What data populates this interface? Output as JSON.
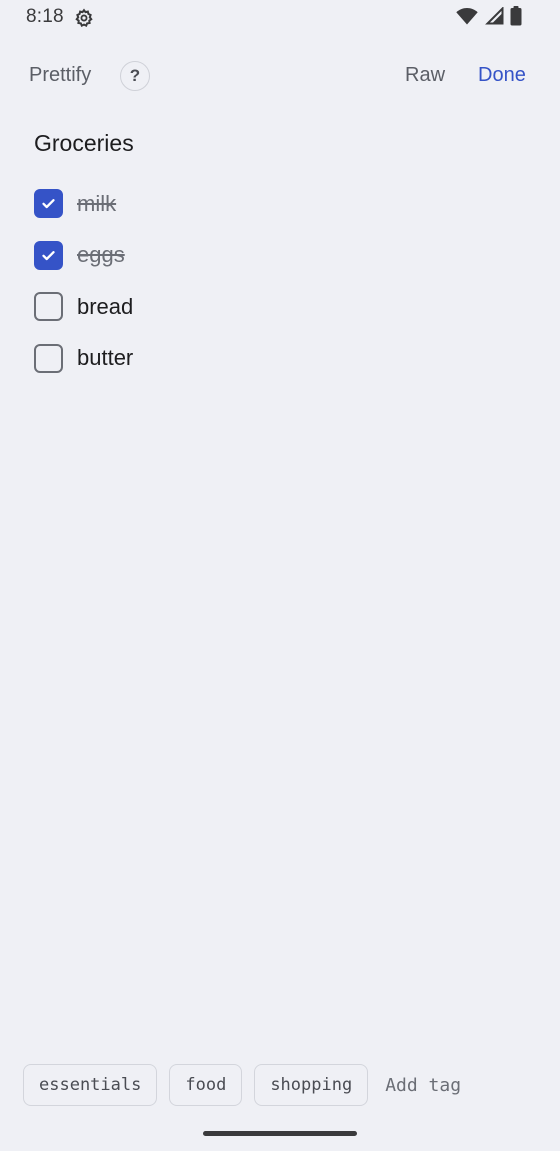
{
  "status_bar": {
    "time": "8:18",
    "icons": [
      "settings-gear-icon",
      "wifi-icon",
      "cell-signal-icon",
      "battery-icon"
    ]
  },
  "toolbar": {
    "prettify_label": "Prettify",
    "help_label": "?",
    "raw_label": "Raw",
    "done_label": "Done"
  },
  "note": {
    "title": "Groceries",
    "items": [
      {
        "label": "milk",
        "checked": true
      },
      {
        "label": "eggs",
        "checked": true
      },
      {
        "label": "bread",
        "checked": false
      },
      {
        "label": "butter",
        "checked": false
      }
    ]
  },
  "tags": {
    "items": [
      "essentials",
      "food",
      "shopping"
    ],
    "add_label": "Add tag"
  },
  "colors": {
    "background": "#eff0f5",
    "accent": "#3553c7",
    "text_primary": "#1d1d1f",
    "text_secondary": "#5b5e66"
  }
}
